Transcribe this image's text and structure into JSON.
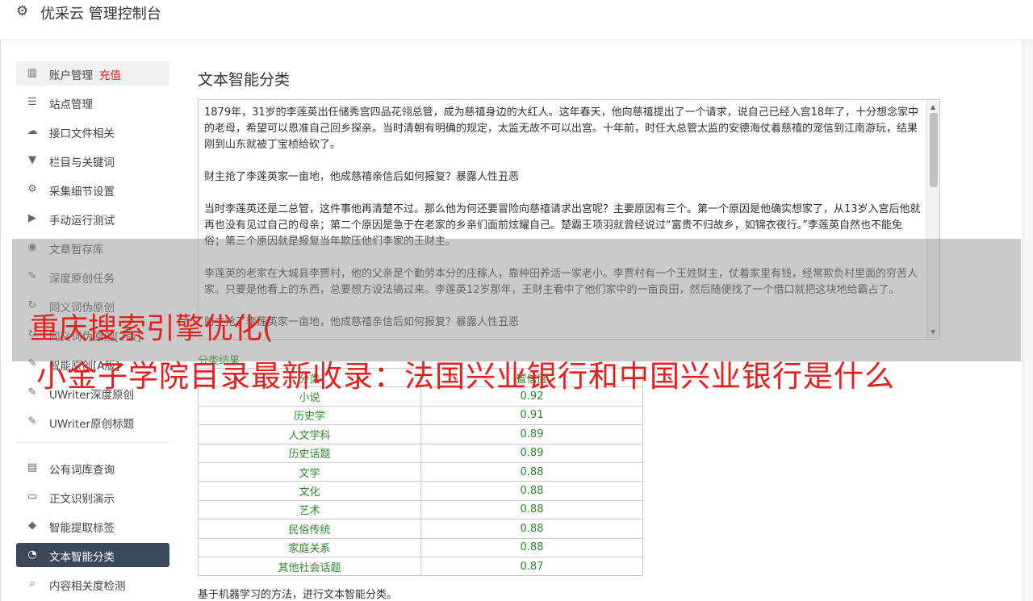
{
  "app": {
    "title": "优采云 管理控制台"
  },
  "sidebar": {
    "group1": [
      {
        "icon": "bar-chart-icon",
        "glyph": "▥",
        "label": "账户管理",
        "tag": "充值"
      },
      {
        "icon": "server-icon",
        "glyph": "☰",
        "label": "站点管理"
      },
      {
        "icon": "cloud-upload-icon",
        "glyph": "☁",
        "label": "接口文件相关"
      },
      {
        "icon": "filter-icon",
        "glyph": "▼",
        "label": "栏目与关键词"
      },
      {
        "icon": "cogs-icon",
        "glyph": "⚙",
        "label": "采集细节设置"
      },
      {
        "icon": "play-circle-icon",
        "glyph": "▶",
        "label": "手动运行测试"
      },
      {
        "icon": "database-icon",
        "glyph": "◉",
        "label": "文章暂存库"
      },
      {
        "icon": "edit-icon",
        "glyph": "✎",
        "label": "深度原创任务"
      },
      {
        "icon": "refresh-icon",
        "glyph": "↻",
        "label": "同义词伪原创"
      },
      {
        "icon": "refresh-icon",
        "glyph": "↻",
        "label": "同义词伪原创[2版]"
      },
      {
        "icon": "edit-icon",
        "glyph": "✎",
        "label": "智能原创[A版]"
      },
      {
        "icon": "edit-icon",
        "glyph": "✎",
        "label": "UWriter深度原创"
      },
      {
        "icon": "edit-icon",
        "glyph": "✎",
        "label": "UWriter原创标题"
      }
    ],
    "group2": [
      {
        "icon": "book-icon",
        "glyph": "▤",
        "label": "公有词库查询"
      },
      {
        "icon": "desktop-icon",
        "glyph": "▭",
        "label": "正文识别演示"
      },
      {
        "icon": "tag-icon",
        "glyph": "◆",
        "label": "智能提取标签"
      },
      {
        "icon": "pie-chart-icon",
        "glyph": "◔",
        "label": "文本智能分类",
        "active": true
      },
      {
        "icon": "search-icon",
        "glyph": "⌕",
        "label": "内容相关度检测"
      }
    ]
  },
  "main": {
    "title": "文本智能分类",
    "textarea_paragraphs": [
      "1879年，31岁的李莲英出任储秀宫四品花翎总管，成为慈禧身边的大红人。这年春天，他向慈禧提出了一个请求，说自己已经入宫18年了，十分想念家中的老母，希望可以恩准自己回乡探亲。当时清朝有明确的规定，太监无故不可以出宫。十年前，时任大总管太监的安德海仗着慈禧的宠信到江南游玩，结果刚到山东就被丁宝桢给砍了。",
      "财主抢了李莲英家一亩地，他成慈禧亲信后如何报复？暴露人性丑恶",
      "当时李莲英还是二总管，这件事他再清楚不过。那么他为何还要冒险向慈禧请求出宫呢？主要原因有三个。第一个原因是他确实想家了，从13岁入宫后他就再也没有见过自己的母亲；第二个原因是急于在老家的乡亲们面前炫耀自己。楚霸王项羽就曾经说过“富贵不归故乡，如锦衣夜行。”李莲英自然也不能免俗；第三个原因就是报复当年欺压他们李家的王财主。",
      "李莲英的老家在大城县李贾村，他的父亲是个勤劳本分的庄稼人，靠种田养活一家老小。李贾村有一个王姓财主，仗着家里有钱，经常欺负村里面的穷苦人家。只要是他看上的东西，总要想方设法搞过来。李莲英12岁那年，王财主看中了他们家中的一亩良田，然后随便找了一个借口就把这块地给霸占了。",
      "财主抢了李莲英家一亩地，他成慈禧亲信后如何报复？暴露人性丑恶"
    ],
    "result_label": "分类结果",
    "table_headers": [
      "分类",
      "置信度"
    ],
    "table_rows": [
      [
        "小说",
        "0.92"
      ],
      [
        "历史学",
        "0.91"
      ],
      [
        "人文学科",
        "0.89"
      ],
      [
        "历史话题",
        "0.89"
      ],
      [
        "文学",
        "0.88"
      ],
      [
        "文化",
        "0.88"
      ],
      [
        "艺术",
        "0.88"
      ],
      [
        "民俗传统",
        "0.88"
      ],
      [
        "家庭关系",
        "0.88"
      ],
      [
        "其他社会话题",
        "0.87"
      ]
    ],
    "note": "基于机器学习的方法，进行文本智能分类。"
  },
  "overlay": {
    "line1": "重庆搜索引擎优化(",
    "line2": "小金子学院目录最新收录：法国兴业银行和中国兴业银行是什么"
  },
  "colors": {
    "accent_red": "#e61e1e",
    "active_bg": "#3b4a5a",
    "result_green": "#2a8a2a"
  }
}
